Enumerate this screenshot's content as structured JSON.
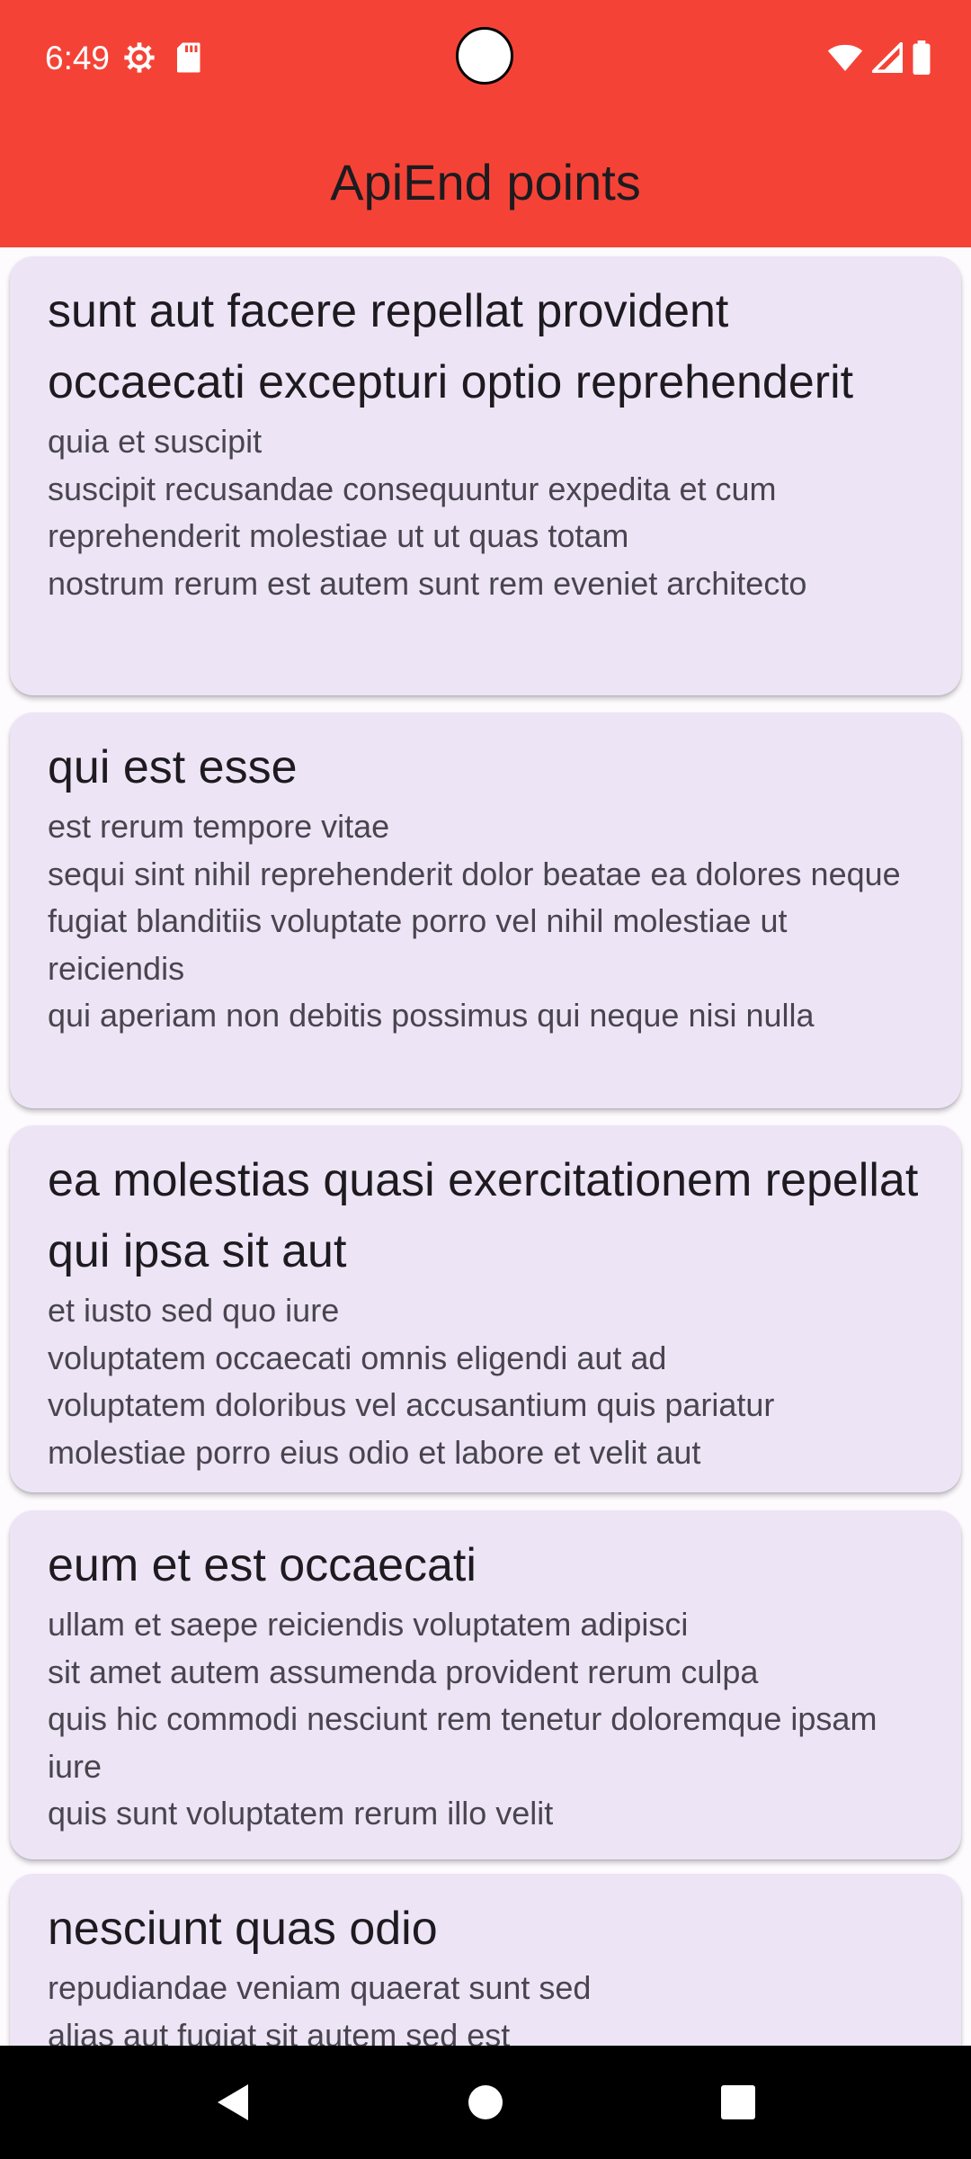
{
  "status_bar": {
    "time": "6:49",
    "left_icons": [
      "settings-icon",
      "sd-card-icon"
    ],
    "right_icons": [
      "wifi-icon",
      "cell-signal-icon",
      "battery-icon"
    ]
  },
  "app_bar": {
    "title": "ApiEnd points",
    "color": "#f44336"
  },
  "posts": [
    {
      "title": "sunt aut facere repellat provident occaecati excepturi optio reprehenderit",
      "body": "quia et suscipit\nsuscipit recusandae consequuntur expedita et cum reprehenderit molestiae ut ut quas totam\nnostrum rerum est autem sunt rem eveniet architecto"
    },
    {
      "title": "qui est esse",
      "body": "est rerum tempore vitae\nsequi sint nihil reprehenderit dolor beatae ea dolores neque\nfugiat blanditiis voluptate porro vel nihil molestiae ut reiciendis\nqui aperiam non debitis possimus qui neque nisi nulla"
    },
    {
      "title": "ea molestias quasi exercitationem repellat qui ipsa sit aut",
      "body": "et iusto sed quo iure\nvoluptatem occaecati omnis eligendi aut ad\nvoluptatem doloribus vel accusantium quis pariatur\nmolestiae porro eius odio et labore et velit aut"
    },
    {
      "title": "eum et est occaecati",
      "body": "ullam et saepe reiciendis voluptatem adipisci\nsit amet autem assumenda provident rerum culpa\nquis hic commodi nesciunt rem tenetur doloremque ipsam iure\nquis sunt voluptatem rerum illo velit"
    },
    {
      "title": "nesciunt quas odio",
      "body": "repudiandae veniam quaerat sunt sed\nalias aut fugiat sit autem sed est"
    }
  ],
  "nav_bar": {
    "buttons": [
      "back-icon",
      "home-icon",
      "recents-icon"
    ]
  }
}
